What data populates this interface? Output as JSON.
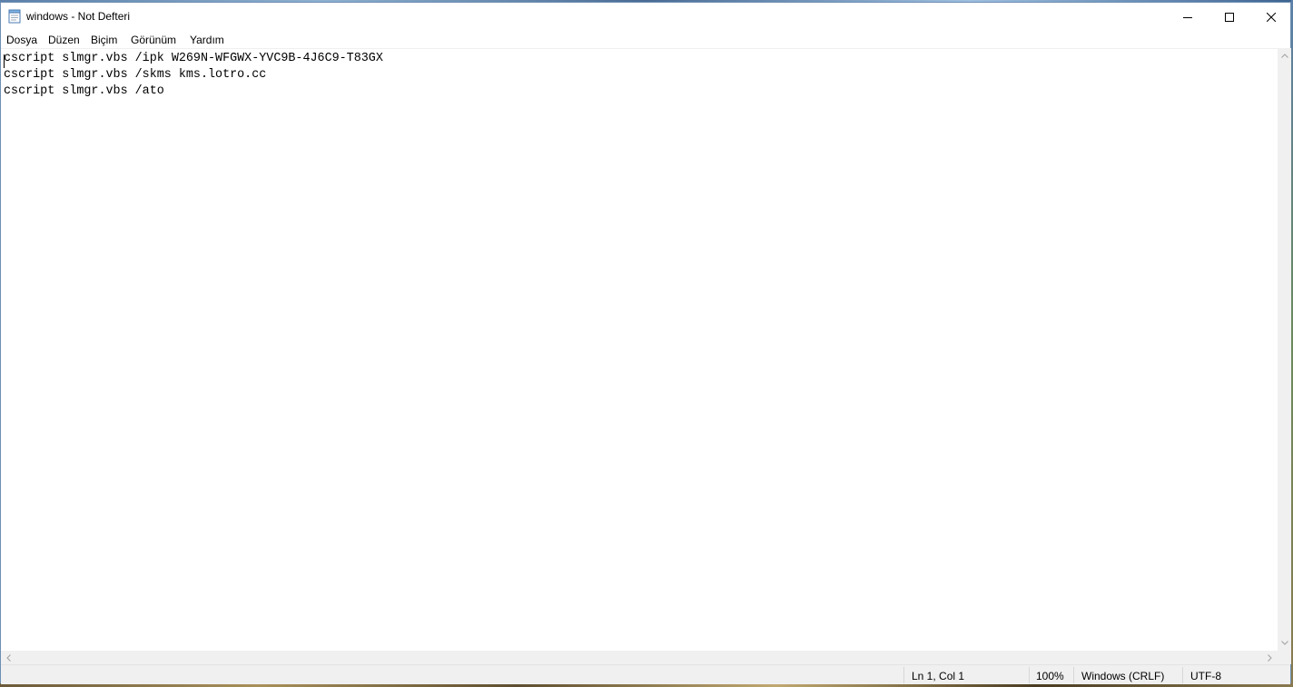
{
  "window": {
    "title": "windows - Not Defteri"
  },
  "menu": {
    "items": [
      "Dosya",
      "Düzen",
      "Biçim",
      "Görünüm",
      "Yardım"
    ]
  },
  "editor": {
    "lines": [
      "cscript slmgr.vbs /ipk W269N-WFGWX-YVC9B-4J6C9-T83GX",
      "cscript slmgr.vbs /skms kms.lotro.cc",
      "cscript slmgr.vbs /ato"
    ]
  },
  "status": {
    "position": "Ln 1, Col 1",
    "zoom": "100%",
    "line_ending": "Windows (CRLF)",
    "encoding": "UTF-8"
  },
  "icons": {
    "app": "notepad-icon",
    "minimize": "minimize-icon",
    "maximize": "maximize-icon",
    "close": "close-icon"
  }
}
